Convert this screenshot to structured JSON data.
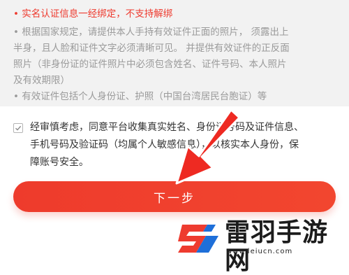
{
  "notice": {
    "lines": [
      "• 实名认证信息一经绑定，不支持解绑",
      "• 根据国家规定，请提供本人手持有效证件正面的照片， 须露出上",
      "半身，且人脸和证件文字必须清晰可见。 并提供有效证件的正反面",
      "照片（非身份证的证件照片中必须包含姓名、证件号码、本人照片",
      "及有效期限）",
      "• 有效证件包括个人身份证、护照（中国台湾居民台胞证）等"
    ]
  },
  "consent": {
    "checked": true,
    "lines": [
      "经审慎考虑，同意平台收集真实姓名、身份证号码及证件信息、",
      "手机号码及验证码（均属个人敏感信息），以核实本人身份，保",
      "障账号安全。"
    ]
  },
  "next_button": {
    "label": "下一步"
  },
  "watermark": {
    "title": "雷羽手游网",
    "url": "www.leiucn.com"
  },
  "colors": {
    "accent": "#ee3b2f",
    "notice_bg": "#f2f2f2",
    "watermark_blue": "#1e6fd9"
  }
}
